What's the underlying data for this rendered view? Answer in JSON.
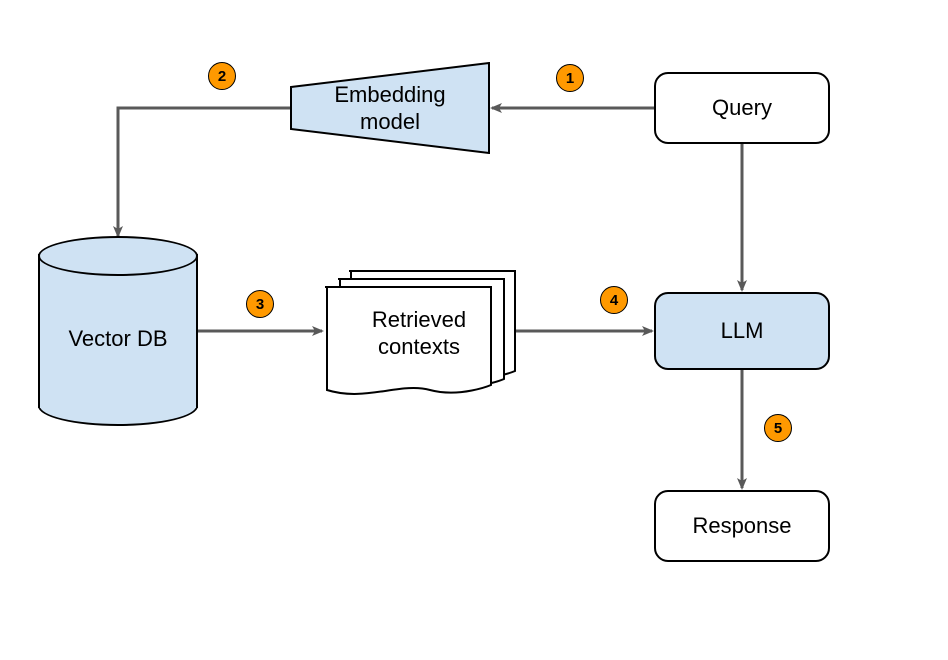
{
  "nodes": {
    "query": {
      "label": "Query"
    },
    "embedding_model": {
      "label": "Embedding\nmodel"
    },
    "vector_db": {
      "label": "Vector DB"
    },
    "retrieved_contexts": {
      "label": "Retrieved\ncontexts"
    },
    "llm": {
      "label": "LLM"
    },
    "response": {
      "label": "Response"
    }
  },
  "steps": {
    "s1": "1",
    "s2": "2",
    "s3": "3",
    "s4": "4",
    "s5": "5"
  },
  "flow": [
    {
      "step": 1,
      "from": "query",
      "to": "embedding_model"
    },
    {
      "step": 2,
      "from": "embedding_model",
      "to": "vector_db"
    },
    {
      "step": 3,
      "from": "vector_db",
      "to": "retrieved_contexts"
    },
    {
      "step": 4,
      "from": "retrieved_contexts",
      "to": "llm"
    },
    {
      "step": 4,
      "also_from": "query",
      "to": "llm"
    },
    {
      "step": 5,
      "from": "llm",
      "to": "response"
    }
  ],
  "colors": {
    "node_fill_blue": "#cfe2f3",
    "badge_fill": "#ff9900",
    "stroke": "#595959"
  }
}
